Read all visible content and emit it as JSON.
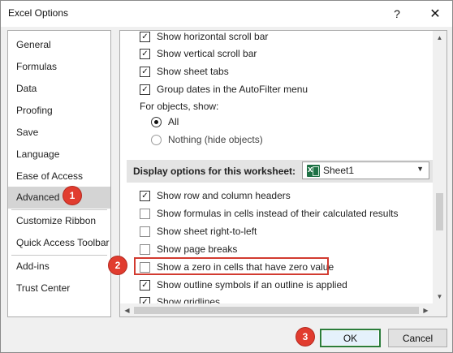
{
  "window": {
    "title": "Excel Options",
    "help_label": "?",
    "close_label": "✕"
  },
  "nav": {
    "items": [
      {
        "label": "General"
      },
      {
        "label": "Formulas"
      },
      {
        "label": "Data"
      },
      {
        "label": "Proofing"
      },
      {
        "label": "Save"
      },
      {
        "label": "Language"
      },
      {
        "label": "Ease of Access"
      },
      {
        "label": "Advanced",
        "selected": true
      },
      {
        "label": "Customize Ribbon"
      },
      {
        "label": "Quick Access Toolbar"
      },
      {
        "label": "Add-ins"
      },
      {
        "label": "Trust Center"
      }
    ]
  },
  "content": {
    "workbook_options": [
      {
        "label": "Show horizontal scroll bar",
        "checked": true
      },
      {
        "label": "Show vertical scroll bar",
        "checked": true
      },
      {
        "label": "Show sheet tabs",
        "checked": true
      },
      {
        "label": "Group dates in the AutoFilter menu",
        "checked": true
      }
    ],
    "objects_label": "For objects, show:",
    "object_options": [
      {
        "label": "All",
        "selected": true
      },
      {
        "label": "Nothing (hide objects)",
        "selected": false
      }
    ],
    "worksheet_section": {
      "title": "Display options for this worksheet:",
      "sheet_value": "Sheet1",
      "dropdown_icon": "chevron-down-icon",
      "sheet_icon": "excel-sheet-icon"
    },
    "worksheet_options": [
      {
        "label": "Show row and column headers",
        "checked": true
      },
      {
        "label": "Show formulas in cells instead of their calculated results",
        "checked": false
      },
      {
        "label": "Show sheet right-to-left",
        "checked": false
      },
      {
        "label": "Show page breaks",
        "checked": false
      },
      {
        "label": "Show a zero in cells that have zero value",
        "checked": false,
        "highlighted": true
      },
      {
        "label": "Show outline symbols if an outline is applied",
        "checked": true
      },
      {
        "label": "Show gridlines",
        "checked": true
      }
    ]
  },
  "annotations": {
    "step1": "1",
    "step2": "2",
    "step3": "3",
    "color": "#e13c2f"
  },
  "buttons": {
    "ok_label": "OK",
    "cancel_label": "Cancel"
  },
  "check_glyph": "✓"
}
